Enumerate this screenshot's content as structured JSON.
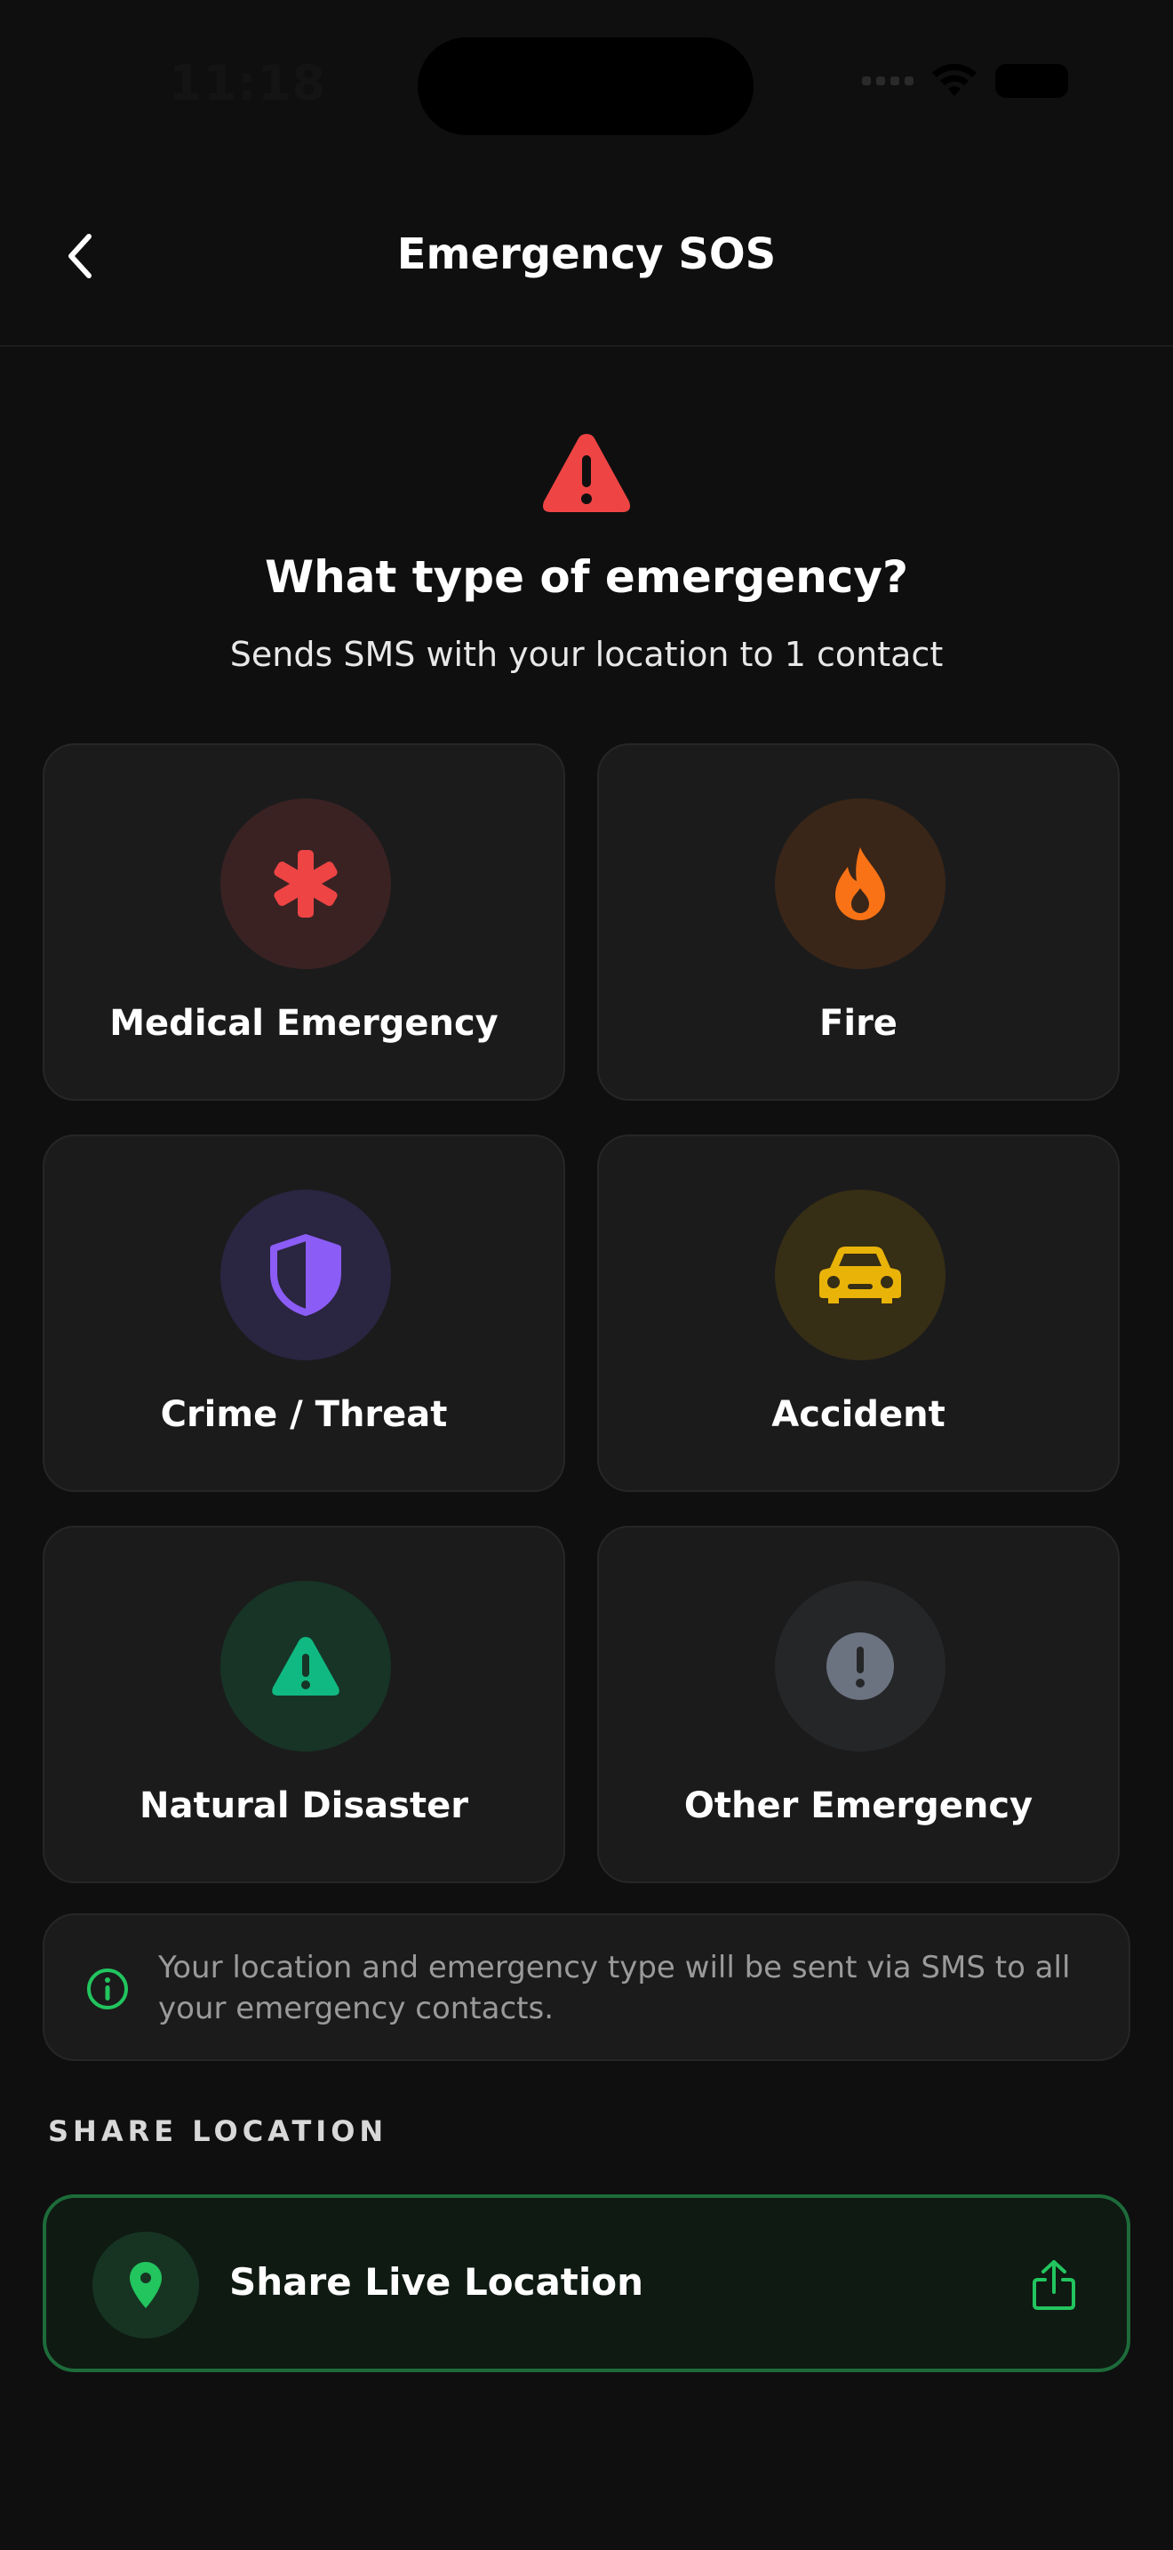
{
  "status_bar": {
    "time": "11:18"
  },
  "header": {
    "title": "Emergency SOS"
  },
  "hero": {
    "title": "What type of emergency?",
    "subtitle": "Sends SMS with your location to 1 contact",
    "icon": "warning-triangle-icon",
    "color": "#ef4444"
  },
  "emergency_types": [
    {
      "label": "Medical Emergency",
      "icon": "medical-asterisk-icon",
      "color": "#ef4444",
      "bg": "#3a2223"
    },
    {
      "label": "Fire",
      "icon": "flame-icon",
      "color": "#f97316",
      "bg": "#3a2618"
    },
    {
      "label": "Crime / Threat",
      "icon": "shield-icon",
      "color": "#8b5cf6",
      "bg": "#2a2540"
    },
    {
      "label": "Accident",
      "icon": "car-icon",
      "color": "#eab308",
      "bg": "#362e15"
    },
    {
      "label": "Natural Disaster",
      "icon": "warning-triangle-icon",
      "color": "#10b981",
      "bg": "#173427"
    },
    {
      "label": "Other Emergency",
      "icon": "exclamation-circle-icon",
      "color": "#6b7280",
      "bg": "#252628"
    }
  ],
  "info": {
    "text": "Your location and emergency type will be sent via SMS to all your emergency contacts.",
    "icon": "info-icon",
    "color": "#22c55e"
  },
  "share_section": {
    "label": "SHARE LOCATION",
    "button_label": "Share Live Location",
    "icon": "location-pin-icon",
    "action_icon": "share-icon",
    "accent": "#22c55e"
  }
}
